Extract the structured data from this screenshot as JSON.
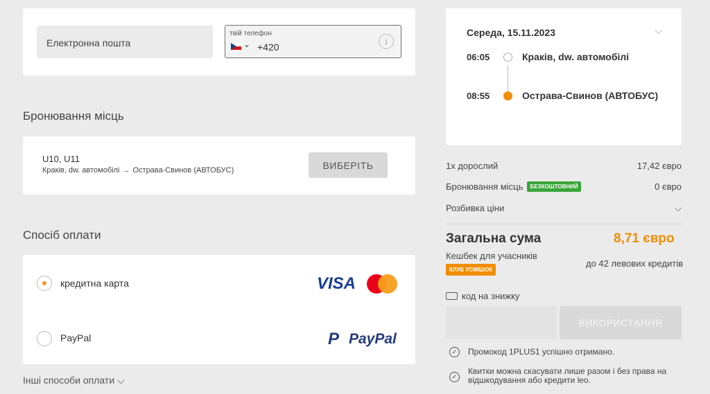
{
  "contact": {
    "email_placeholder": "Електронна пошта",
    "phone_label": "твій телефон",
    "phone_prefix": "+420",
    "info_glyph": "i"
  },
  "seat_booking": {
    "title": "Бронювання місць",
    "seats": "U10, U11",
    "from": "Краків, dw. автомобілі",
    "arrow": "→",
    "to": "Острава-Свинов (АВТОБУС)",
    "choose_label": "ВИБЕРІТЬ"
  },
  "payment": {
    "title": "Спосіб оплати",
    "options": [
      {
        "label": "кредитна карта",
        "selected": true,
        "logo": "VISA"
      },
      {
        "label": "PayPal",
        "selected": false,
        "logo": "PayPal"
      }
    ],
    "paypal_p": "P",
    "other": "Інші способи оплати ⌵"
  },
  "trip": {
    "date": "Середа, 15.11.2023",
    "stops": [
      {
        "time": "06:05",
        "name": "Краків, dw. автомобілі"
      },
      {
        "time": "08:55",
        "name": "Острава-Свинов (АВТОБУС)"
      }
    ]
  },
  "summary": {
    "adult_label": "1x дорослий",
    "adult_price": "17,42 євро",
    "seat_label": "Бронювання місць",
    "seat_badge": "БЕЗКОШТОВНИЙ",
    "seat_price": "0 євро",
    "breakdown_label": "Розбивка ціни",
    "total_label": "Загальна сума",
    "total_value": "8,71 євро",
    "cashback_label": "Кешбек для учасників",
    "club_badge": "КЛУБ УСМІШОК",
    "credits": "до  42  левових кредитів"
  },
  "discount": {
    "title": "код на знижку",
    "apply_label": "ВИКОРИСТАННЯ",
    "input_value": ""
  },
  "notes": [
    "Промокод 1PLUS1 успішно отримано.",
    "Квитки можна скасувати лише разом і без права на відшкодування або кредити leo."
  ],
  "colors": {
    "accent": "#f18d00",
    "green": "#38a538",
    "background": "#ebebeb"
  }
}
